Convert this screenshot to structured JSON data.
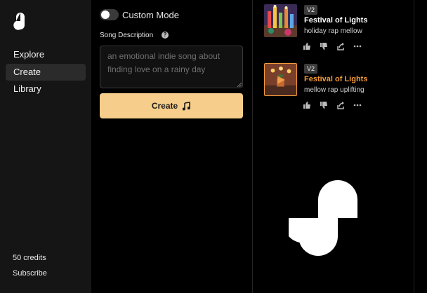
{
  "sidebar": {
    "logo_icon": "wave-logo-icon",
    "items": [
      {
        "label": "Explore",
        "active": false
      },
      {
        "label": "Create",
        "active": true
      },
      {
        "label": "Library",
        "active": false
      }
    ],
    "credits": "50 credits",
    "subscribe": "Subscribe"
  },
  "create_panel": {
    "custom_mode_label": "Custom Mode",
    "custom_mode_on": false,
    "description_label": "Song Description",
    "help_icon": "help-circle-icon",
    "description_placeholder": "an emotional indie song about finding love on a rainy day",
    "create_label": "Create",
    "create_icon": "music-note-icon",
    "accent": "#f6cd8a"
  },
  "songs": [
    {
      "badge": "V2",
      "title": "Festival of Lights",
      "tags": "holiday rap mellow",
      "playing": false
    },
    {
      "badge": "V2",
      "title": "Festival of Lights",
      "tags": "mellow rap uplifting",
      "playing": true
    }
  ],
  "highlight_color": "#f39b3c"
}
